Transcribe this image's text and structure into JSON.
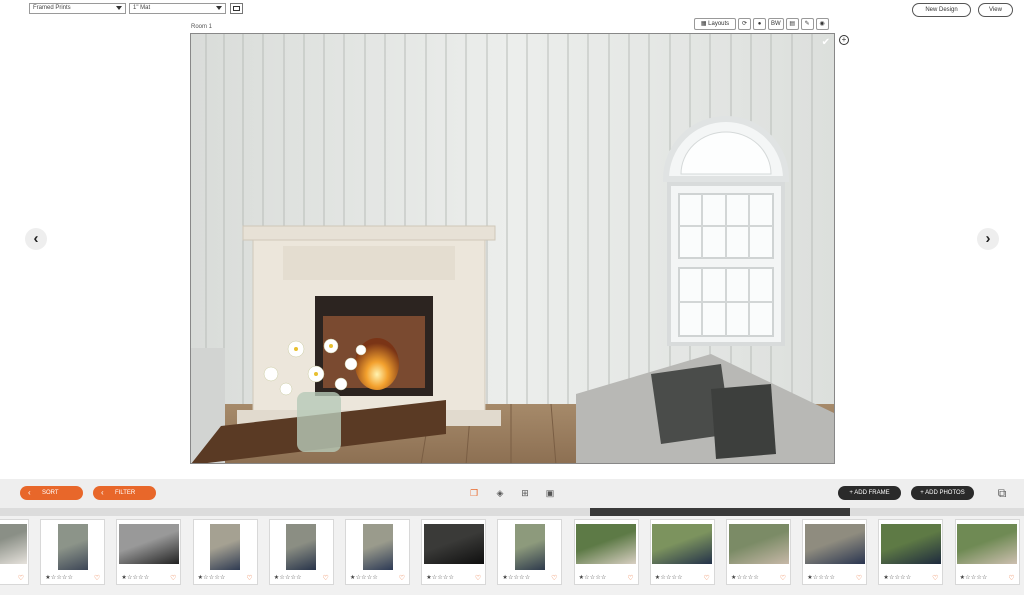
{
  "topbar": {
    "product_select": "Framed Prints",
    "mat_select": "1\" Mat",
    "new_design_label": "New Design",
    "view_label": "View"
  },
  "room": {
    "label": "Room 1",
    "toolbar": {
      "layouts_label": "Layouts",
      "bw_label": "BW"
    }
  },
  "bottombar": {
    "sort_label": "SORT",
    "filter_label": "FILTER",
    "add_frame_label": "+ ADD FRAME",
    "add_photos_label": "+ ADD PHOTOS"
  },
  "thumbnails": [
    {
      "rating": "☆☆",
      "orientation": "landscape",
      "colors": [
        "#8a8f86",
        "#e6e2dc"
      ]
    },
    {
      "rating": "★☆☆☆☆",
      "orientation": "portrait",
      "colors": [
        "#8c9489",
        "#3d4656"
      ]
    },
    {
      "rating": "★☆☆☆☆",
      "orientation": "landscape",
      "colors": [
        "#999",
        "#222"
      ]
    },
    {
      "rating": "★☆☆☆☆",
      "orientation": "portrait",
      "colors": [
        "#a5a192",
        "#2f3b52"
      ]
    },
    {
      "rating": "★☆☆☆☆",
      "orientation": "portrait",
      "colors": [
        "#8b8e83",
        "#28344a"
      ]
    },
    {
      "rating": "★☆☆☆☆",
      "orientation": "portrait",
      "colors": [
        "#9a9b8c",
        "#2d3a55"
      ]
    },
    {
      "rating": "★☆☆☆☆",
      "orientation": "landscape",
      "colors": [
        "#3a3a38",
        "#0f0f0f"
      ]
    },
    {
      "rating": "★☆☆☆☆",
      "orientation": "portrait",
      "colors": [
        "#8d9a7c",
        "#2e3a4c"
      ]
    },
    {
      "rating": "★☆☆☆☆",
      "orientation": "landscape",
      "colors": [
        "#5d7a46",
        "#d8cfc2"
      ]
    },
    {
      "rating": "★☆☆☆☆",
      "orientation": "landscape",
      "colors": [
        "#7c935e",
        "#24324a"
      ]
    },
    {
      "rating": "★☆☆☆☆",
      "orientation": "landscape",
      "colors": [
        "#7b8b66",
        "#c7b8a8"
      ]
    },
    {
      "rating": "★☆☆☆☆",
      "orientation": "landscape",
      "colors": [
        "#8f8c7f",
        "#2a3550"
      ]
    },
    {
      "rating": "★☆☆☆☆",
      "orientation": "landscape",
      "colors": [
        "#5e7a45",
        "#1e2a3e"
      ]
    },
    {
      "rating": "★☆☆☆☆",
      "orientation": "landscape",
      "colors": [
        "#6f8a54",
        "#cdbfb0"
      ]
    }
  ],
  "colors": {
    "accent_orange": "#e8672a",
    "dark_button": "#2a2a2a"
  }
}
